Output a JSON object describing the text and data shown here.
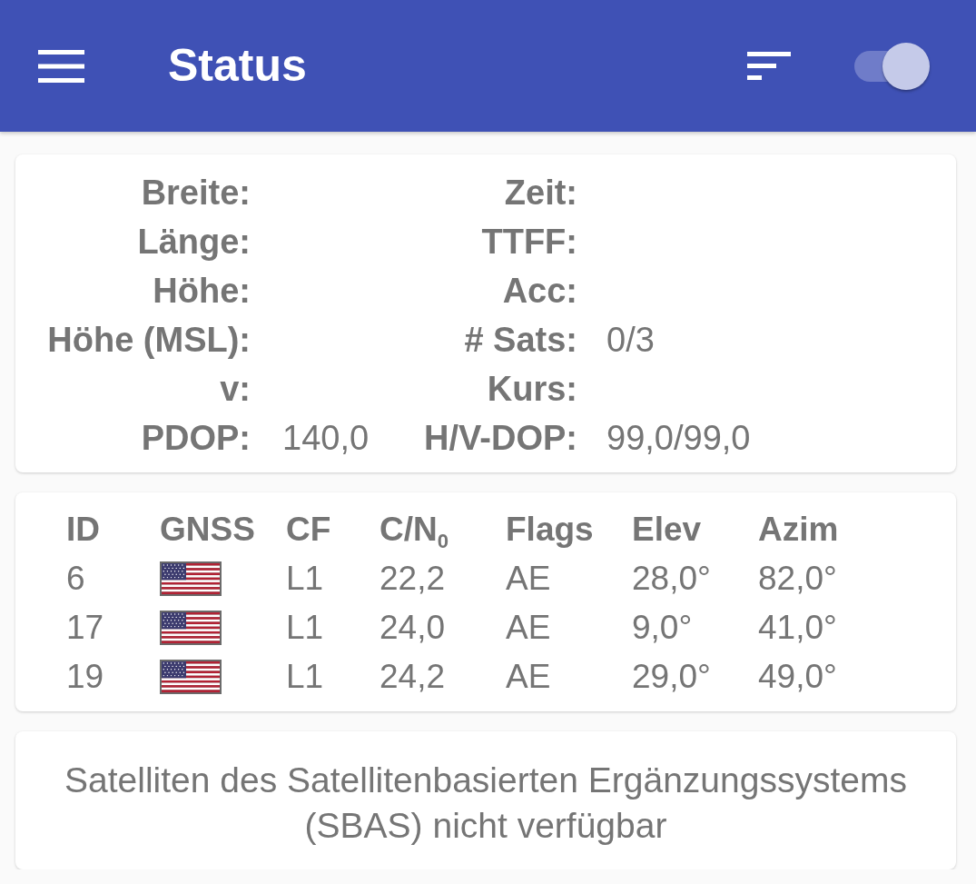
{
  "app_bar": {
    "title": "Status",
    "switch": {
      "on": true
    }
  },
  "position": {
    "rows": [
      {
        "left": {
          "label": "Breite:"
        },
        "right": {
          "label": "Zeit:"
        }
      },
      {
        "left": {
          "label": "Länge:"
        },
        "right": {
          "label": "TTFF:"
        }
      },
      {
        "left": {
          "label": "Höhe:"
        },
        "right": {
          "label": "Acc:"
        }
      },
      {
        "left": {
          "label": "Höhe (MSL):"
        },
        "right": {
          "label": "# Sats:",
          "value": "0/3"
        }
      },
      {
        "left": {
          "label": "v:"
        },
        "right": {
          "label": "Kurs:"
        }
      },
      {
        "left": {
          "label": "PDOP:",
          "value": "140,0"
        },
        "right": {
          "label": "H/V-DOP:",
          "value": "99,0/99,0"
        }
      }
    ]
  },
  "satellites": {
    "columns": [
      "ID",
      "GNSS",
      "CF",
      "C/N$_{0}$",
      "Flags",
      "Elev",
      "Azim"
    ],
    "rows": [
      {
        "id": "6",
        "cf": "L1",
        "cn0": "22,2",
        "flags": "AE",
        "elev": "28,0°",
        "azim": "82,0°"
      },
      {
        "id": "17",
        "cf": "L1",
        "cn0": "24,0",
        "flags": "AE",
        "elev": "9,0°",
        "azim": "41,0°"
      },
      {
        "id": "19",
        "cf": "L1",
        "cn0": "24,2",
        "flags": "AE",
        "elev": "29,0°",
        "azim": "49,0°"
      }
    ]
  },
  "sbas": {
    "message": "Satelliten des Satellitenbasierten Ergänzungssystems (SBAS) nicht verfügbar"
  }
}
